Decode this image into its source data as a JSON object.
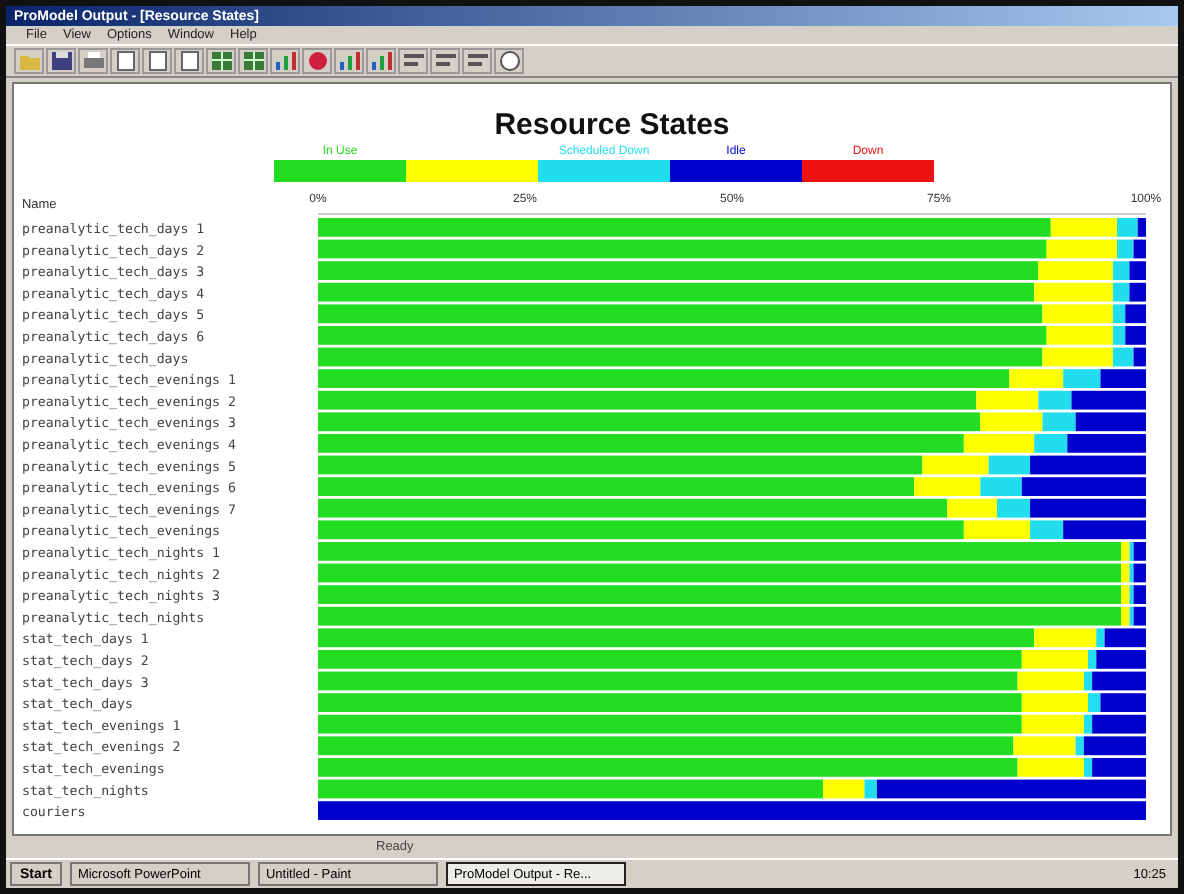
{
  "window": {
    "title": "ProModel Output - [Resource States]"
  },
  "menu": [
    "File",
    "View",
    "Options",
    "Window",
    "Help"
  ],
  "chart": {
    "title": "Resource States",
    "header": "Name",
    "chart_data": {
      "type": "bar",
      "orientation": "horizontal",
      "stacked": true,
      "xlim": [
        0,
        1
      ],
      "xticks": [
        {
          "value": 0,
          "label": "0%"
        },
        {
          "value": 0.25,
          "label": "25%"
        },
        {
          "value": 0.5,
          "label": "50%"
        },
        {
          "value": 0.75,
          "label": "75%"
        },
        {
          "value": 1,
          "label": "100%"
        }
      ],
      "categories": [
        "preanalytic_tech_days 1",
        "preanalytic_tech_days 2",
        "preanalytic_tech_days 3",
        "preanalytic_tech_days 4",
        "preanalytic_tech_days 5",
        "preanalytic_tech_days 6",
        "preanalytic_tech_days",
        "preanalytic_tech_evenings 1",
        "preanalytic_tech_evenings 2",
        "preanalytic_tech_evenings 3",
        "preanalytic_tech_evenings 4",
        "preanalytic_tech_evenings 5",
        "preanalytic_tech_evenings 6",
        "preanalytic_tech_evenings 7",
        "preanalytic_tech_evenings",
        "preanalytic_tech_nights 1",
        "preanalytic_tech_nights 2",
        "preanalytic_tech_nights 3",
        "preanalytic_tech_nights",
        "stat_tech_days 1",
        "stat_tech_days 2",
        "stat_tech_days 3",
        "stat_tech_days",
        "stat_tech_evenings 1",
        "stat_tech_evenings 2",
        "stat_tech_evenings",
        "stat_tech_nights",
        "couriers"
      ],
      "series": [
        {
          "name": "In Use",
          "color": "#22dd22",
          "values": [
            0.885,
            0.88,
            0.87,
            0.865,
            0.875,
            0.88,
            0.875,
            0.835,
            0.795,
            0.8,
            0.78,
            0.73,
            0.72,
            0.76,
            0.78,
            0.97,
            0.97,
            0.97,
            0.97,
            0.865,
            0.85,
            0.845,
            0.85,
            0.85,
            0.84,
            0.845,
            0.61,
            0
          ]
        },
        {
          "color": "#ffff00",
          "values": [
            0.08,
            0.085,
            0.09,
            0.095,
            0.085,
            0.08,
            0.085,
            0.065,
            0.075,
            0.075,
            0.085,
            0.08,
            0.08,
            0.06,
            0.08,
            0.01,
            0.01,
            0.01,
            0.01,
            0.075,
            0.08,
            0.08,
            0.08,
            0.075,
            0.075,
            0.08,
            0.05,
            0
          ]
        },
        {
          "name": "Scheduled Down",
          "color": "#22ddee",
          "values": [
            0.025,
            0.02,
            0.02,
            0.02,
            0.015,
            0.015,
            0.025,
            0.045,
            0.04,
            0.04,
            0.04,
            0.05,
            0.05,
            0.04,
            0.04,
            0.005,
            0.005,
            0.005,
            0.005,
            0.01,
            0.01,
            0.01,
            0.015,
            0.01,
            0.01,
            0.01,
            0.015,
            0
          ]
        },
        {
          "name": "Idle",
          "color": "#0000cc",
          "values": [
            0.01,
            0.015,
            0.02,
            0.02,
            0.025,
            0.025,
            0.015,
            0.055,
            0.09,
            0.085,
            0.095,
            0.14,
            0.15,
            0.14,
            0.1,
            0.015,
            0.015,
            0.015,
            0.015,
            0.05,
            0.06,
            0.065,
            0.055,
            0.065,
            0.075,
            0.065,
            0.325,
            1
          ]
        },
        {
          "name": "Down",
          "color": "#ee1111",
          "values": [
            0,
            0,
            0,
            0,
            0,
            0,
            0,
            0,
            0,
            0,
            0,
            0,
            0,
            0,
            0,
            0,
            0,
            0,
            0,
            0,
            0,
            0,
            0,
            0,
            0,
            0,
            0,
            0
          ]
        }
      ]
    }
  },
  "status_bar": [
    "Ready"
  ],
  "taskbar": {
    "start": "Start",
    "tasks": [
      {
        "label": "Microsoft PowerPoint",
        "selected": false
      },
      {
        "label": "Untitled - Paint",
        "selected": false
      },
      {
        "label": "ProModel Output - Re...",
        "selected": true
      }
    ],
    "clock": "10:25"
  }
}
